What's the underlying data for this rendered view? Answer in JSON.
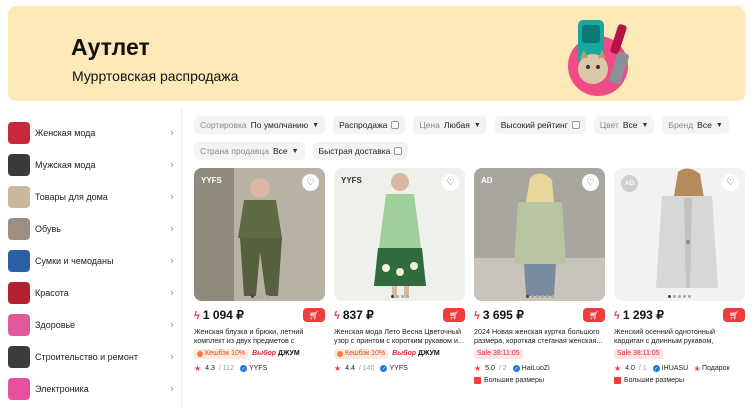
{
  "banner": {
    "title": "Аутлет",
    "subtitle": "Мурртовская распродажа"
  },
  "sidebar": {
    "items": [
      {
        "label": "Женская мода",
        "color": "#c8283c"
      },
      {
        "label": "Мужская мода",
        "color": "#3b3b3b"
      },
      {
        "label": "Товары для дома",
        "color": "#c9b89a"
      },
      {
        "label": "Обувь",
        "color": "#9c8e80"
      },
      {
        "label": "Сумки и чемоданы",
        "color": "#2d5fa6"
      },
      {
        "label": "Красота",
        "color": "#b3202e"
      },
      {
        "label": "Здоровье",
        "color": "#e05a9a"
      },
      {
        "label": "Строительство и ремонт",
        "color": "#3c3c3c"
      },
      {
        "label": "Электроника",
        "color": "#e4509e"
      }
    ]
  },
  "filters": {
    "sort": {
      "label": "Сортировка",
      "value": "По умолчанию"
    },
    "sale": {
      "label": "Распродажа"
    },
    "price": {
      "label": "Цена",
      "value": "Любая"
    },
    "rating": {
      "label": "Высокий рейтинг"
    },
    "color": {
      "label": "Цвет",
      "value": "Все"
    },
    "brand": {
      "label": "Бренд",
      "value": "Все"
    },
    "country": {
      "label": "Страна продавца",
      "value": "Все"
    },
    "fast": {
      "label": "Быстрая доставка"
    }
  },
  "products": [
    {
      "photo_tag": "YYFS",
      "price": "1 094 ₽",
      "title": "Женская блузка и брюки, летний комплект из двух предметов с брюками",
      "cashback": "Кешбэк 10%",
      "choice": {
        "prefix": "Выбор",
        "brand": "ДЖУМ"
      },
      "rating": "4.3",
      "reviews": "/ 112",
      "seller": "YYFS",
      "bg": "#6b6f4d"
    },
    {
      "photo_tag": "YYFS",
      "price": "837 ₽",
      "title": "Женская мода Лето Весна Цветочный узор с принтом с коротким рукавом и...",
      "cashback": "Кешбэк 10%",
      "choice": {
        "prefix": "Выбор",
        "brand": "ДЖУМ"
      },
      "rating": "4.4",
      "reviews": "/ 140",
      "seller": "YYFS",
      "bg": "#7bb28a"
    },
    {
      "photo_tag": "AD",
      "price": "3 695 ₽",
      "title": "2024 Новая женская куртка большого размера, короткая стеганая женская...",
      "sale": "Sale 38:11:05",
      "rating": "5.0",
      "reviews": "/ 2",
      "seller": "HaiLuoZi",
      "bigsizes": "Большие размеры",
      "bg": "#c9c6bf"
    },
    {
      "photo_tag": "AD",
      "price": "1 293 ₽",
      "title": "Женский осенний однотонный кардиган с длинным рукавом, маленький пиджак",
      "sale": "Sale 38:11:05",
      "rating": "4.0",
      "reviews": "/ 1",
      "seller": "IHUASU",
      "gift": "Подарок",
      "bigsizes": "Большие размеры",
      "bg": "#e9e8e6"
    }
  ]
}
